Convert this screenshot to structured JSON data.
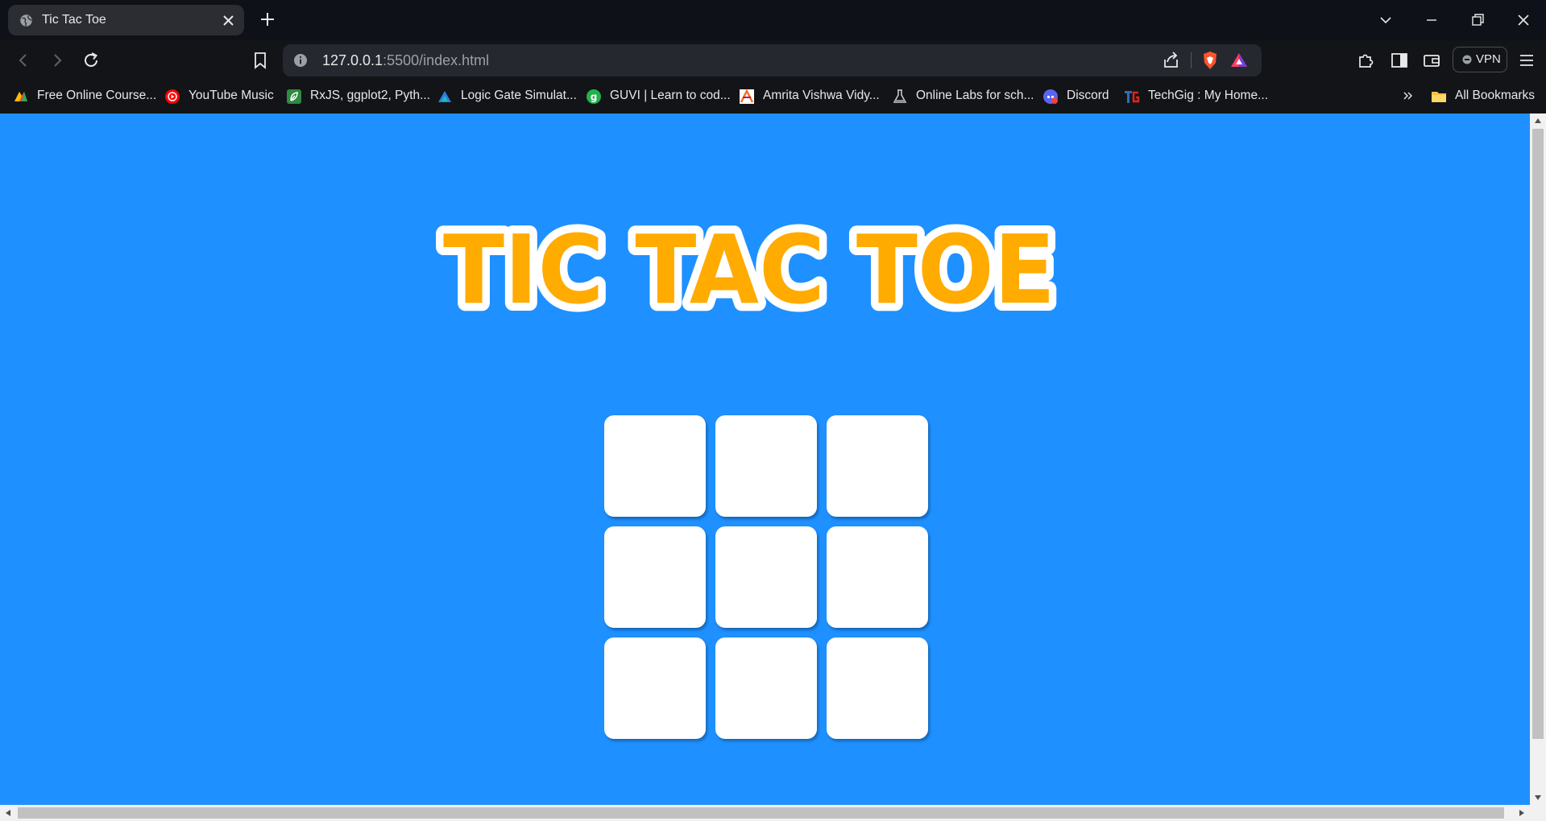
{
  "browser": {
    "tab": {
      "title": "Tic Tac Toe",
      "favicon": "globe-icon"
    },
    "url": {
      "host": "127.0.0.1",
      "rest": ":5500/index.html"
    },
    "vpn_label": "VPN",
    "bookmarks": [
      {
        "label": "Free Online Course...",
        "icon": "google-analytics-icon",
        "color": "#e8453c"
      },
      {
        "label": "YouTube Music",
        "icon": "youtube-music-icon",
        "color": "#ff0000"
      },
      {
        "label": "RxJS, ggplot2, Pyth...",
        "icon": "leaf-icon",
        "color": "#2e8b3f"
      },
      {
        "label": "Logic Gate Simulat...",
        "icon": "logic-gate-icon",
        "color": "#2f7de1"
      },
      {
        "label": "GUVI | Learn to cod...",
        "icon": "guvi-icon",
        "color": "#22b14c"
      },
      {
        "label": "Amrita Vishwa Vidy...",
        "icon": "amrita-icon",
        "color": "#f2711c"
      },
      {
        "label": "Online Labs for sch...",
        "icon": "labs-icon",
        "color": "#8f8f8f"
      },
      {
        "label": "Discord",
        "icon": "discord-icon",
        "color": "#5865f2"
      },
      {
        "label": "TechGig : My Home...",
        "icon": "techgig-icon",
        "color": "#e2231a"
      }
    ],
    "all_bookmarks_label": "All Bookmarks"
  },
  "game": {
    "title": "TIC TAC TOE",
    "cells": [
      "",
      "",
      "",
      "",
      "",
      "",
      "",
      "",
      ""
    ]
  },
  "colors": {
    "background": "#1e90ff",
    "title_fill": "#ffab00",
    "title_outline": "#ffffff",
    "cell": "#ffffff"
  }
}
